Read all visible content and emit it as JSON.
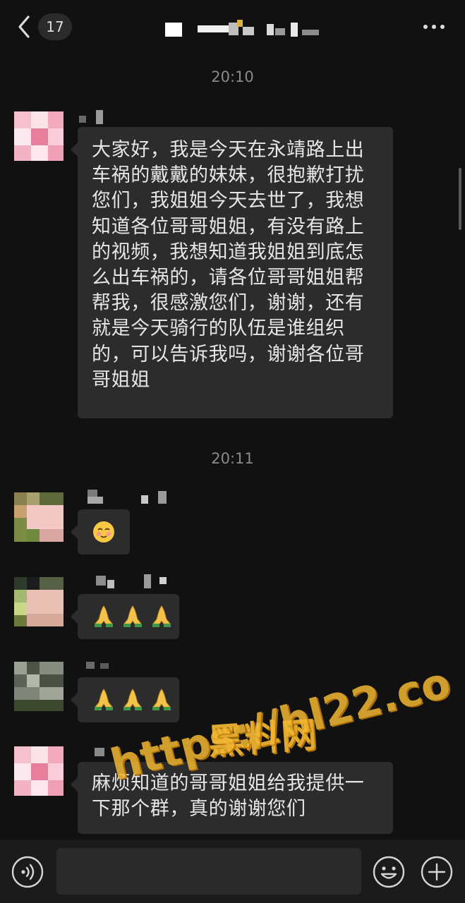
{
  "header": {
    "unread_count": "17",
    "title_pixelated": true
  },
  "messages": [
    {
      "time": "20:10",
      "text": "大家好，我是今天在永靖路上出\n车祸的戴戴的妹妹，很抱歉打扰\n您们，我姐姐今天去世了，我想\n知道各位哥哥姐姐，有没有路上\n的视频，我想知道我姐姐到底怎\n么出车祸的，请各位哥哥姐姐帮\n帮我，很感激您们，谢谢，还有\n就是今天骑行的队伍是谁组织\n的，可以告诉我吗，谢谢各位哥\n哥姐姐"
    },
    {
      "time": "20:11",
      "emoji": "smiling-face-emoji"
    },
    {
      "emoji": "folded-hands-emoji"
    },
    {
      "emoji": "folded-hands-emoji"
    },
    {
      "text": "麻烦知道的哥哥姐姐给我提供一\n下那个群，真的谢谢您们"
    }
  ],
  "watermark": {
    "line1": "黑料网",
    "line2": "https://hl22.co",
    "color": "#f2b733"
  },
  "colors": {
    "background": "#111111",
    "bubble": "#2c2c2c",
    "text": "#e6e6e6",
    "timestamp": "#8a8a8a"
  }
}
